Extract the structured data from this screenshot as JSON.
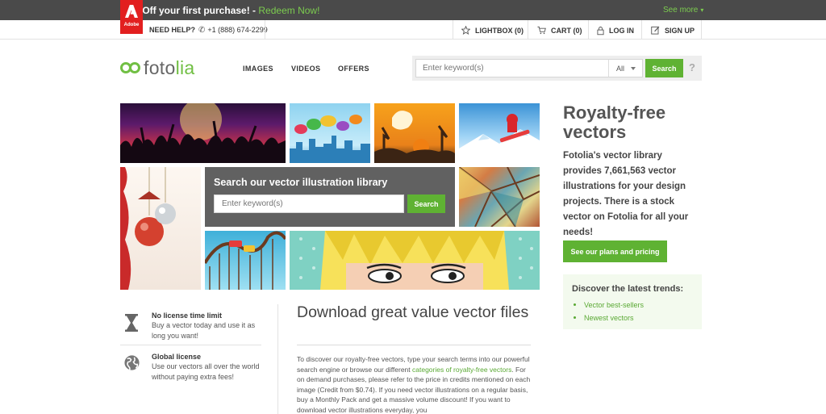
{
  "promo": {
    "text": "20% Off your first purchase! - ",
    "link": "Redeem Now!",
    "see_more": "See more"
  },
  "utility": {
    "brand_word": "Adobe",
    "help_label": "NEED HELP?",
    "phone": "+1 (888) 674-2299",
    "lightbox": "LIGHTBOX (0)",
    "cart": "CART (0)",
    "login": "LOG IN",
    "signup": "SIGN UP"
  },
  "header": {
    "logo_part1": "foto",
    "logo_part2": "lia",
    "nav": [
      "IMAGES",
      "VIDEOS",
      "OFFERS"
    ],
    "search_placeholder": "Enter keyword(s)",
    "filter_value": "All",
    "search_button": "Search",
    "help": "?"
  },
  "hero_search": {
    "title": "Search our vector illustration library",
    "placeholder": "Enter keyword(s)",
    "button": "Search"
  },
  "sidebar": {
    "title": "Royalty-free vectors",
    "description": "Fotolia's vector library provides 7,661,563 vector illustrations for your design projects. There is a stock vector on Fotolia for all your needs!",
    "cta": "See our plans and pricing",
    "trends_title": "Discover the latest trends:",
    "trends": [
      "Vector best-sellers",
      "Newest vectors"
    ]
  },
  "features": [
    {
      "title": "No license time limit",
      "description": "Buy a vector today and use it as long you want!",
      "icon": "hourglass-icon"
    },
    {
      "title": "Global license",
      "description": "Use our vectors all over the world without paying extra fees!",
      "icon": "globe-icon"
    }
  ],
  "main": {
    "title": "Download great value vector files",
    "body_1": "To discover our royalty-free vectors, type your search terms into our powerful search engine or browse our different ",
    "body_link": "categories of royalty-free vectors",
    "body_2": ". For on demand purchases, please refer to the price in credits mentioned on each image (Credit from $0.74). If you need vector illustrations on a regular basis, buy a Monthly Pack and get a massive volume discount! If you want to download vector illustrations everyday, you"
  },
  "colors": {
    "accent_green": "#5fb233",
    "promo_bg": "#4a4a4a",
    "adobe_red": "#e21f1f",
    "panel_gray": "#616161"
  }
}
